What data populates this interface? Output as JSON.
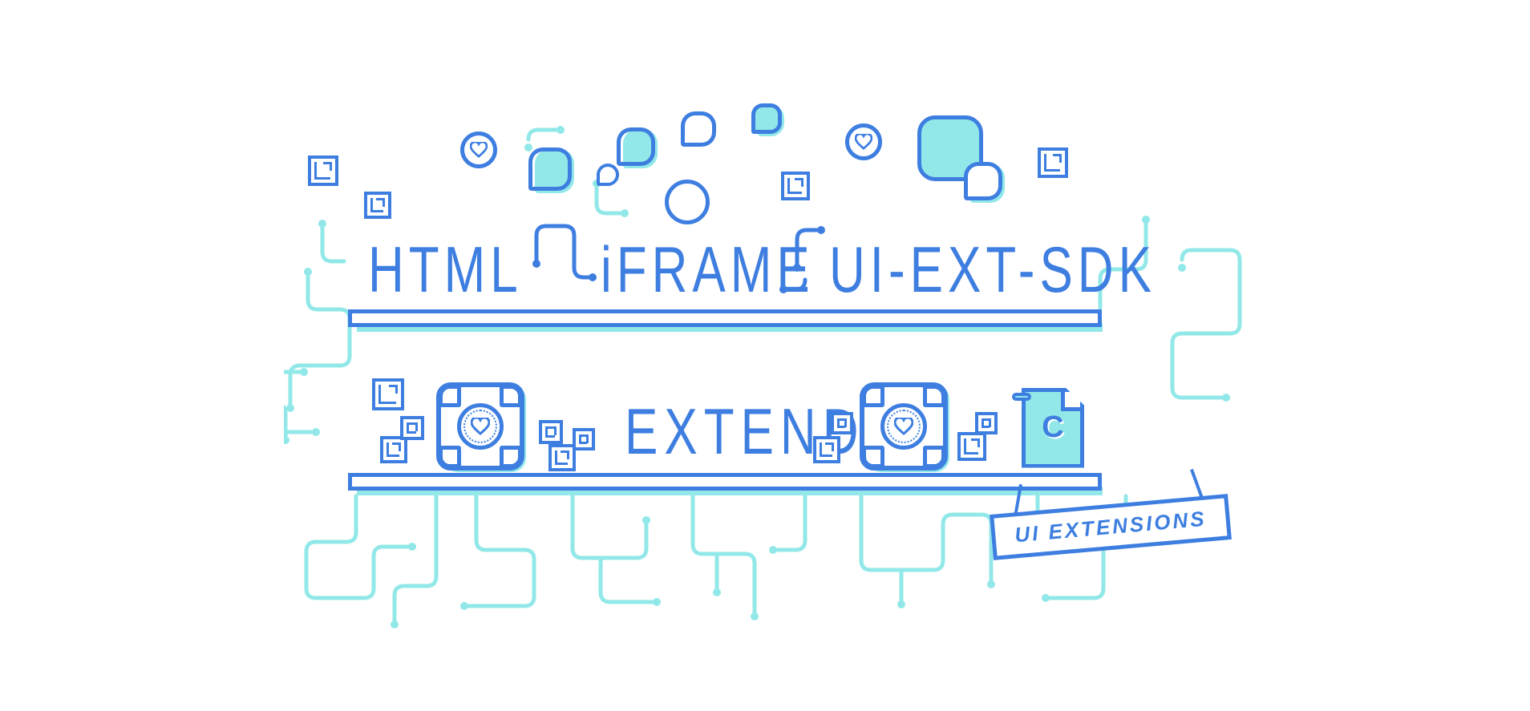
{
  "tech_labels": {
    "html": "HTML",
    "iframe": "iFRAME",
    "sdk": "UI-EXT-SDK"
  },
  "action_label": "EXTEND",
  "badge_label": "UI EXTENSIONS",
  "file_letter": "C",
  "colors": {
    "primary": "#3d7ee0",
    "accent": "#92e8e8"
  }
}
